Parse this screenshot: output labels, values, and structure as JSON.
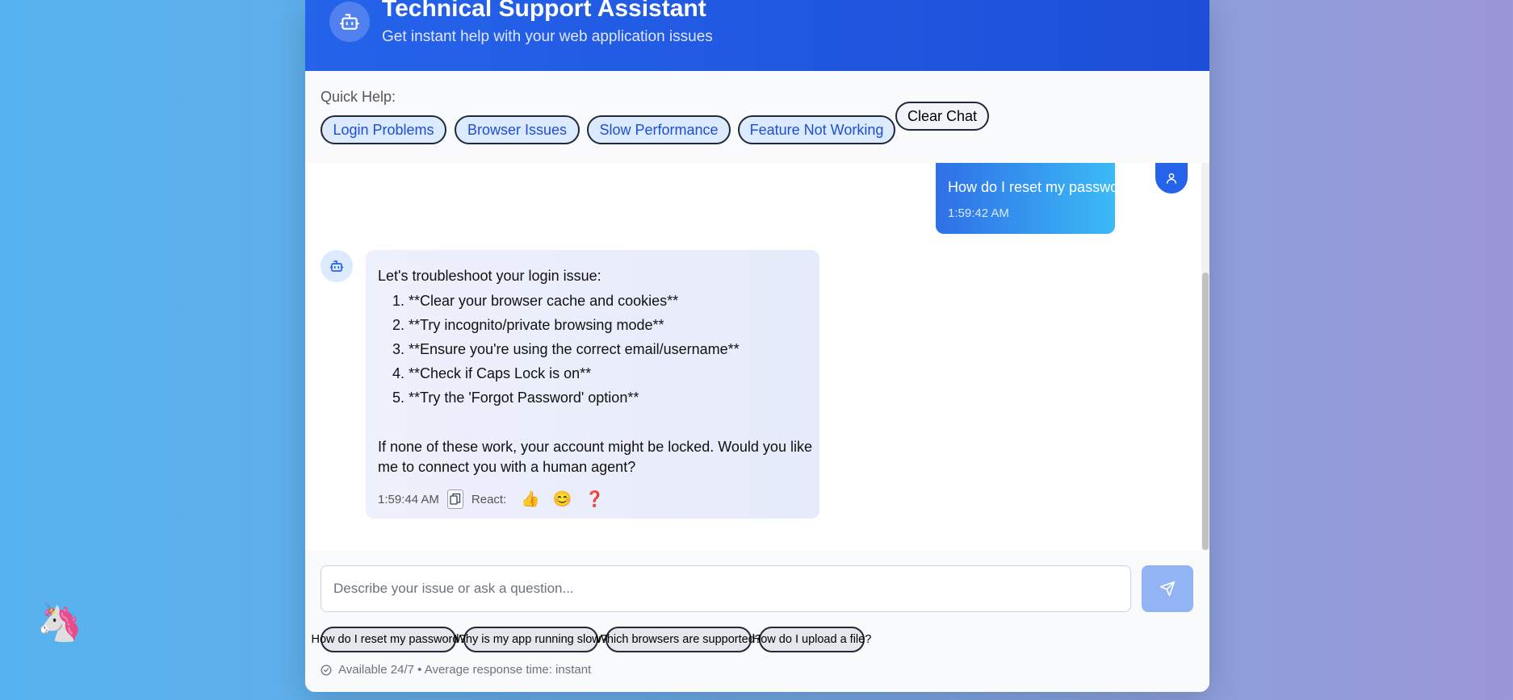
{
  "header": {
    "title": "Technical Support Assistant",
    "subtitle": "Get instant help with your web application issues",
    "icon": "robot-icon"
  },
  "quick_help": {
    "label": "Quick Help:",
    "buttons": [
      "Login Problems",
      "Browser Issues",
      "Slow Performance",
      "Feature Not Working"
    ],
    "clear_label": "Clear Chat"
  },
  "messages": {
    "user": {
      "text": "How do I reset my password?",
      "time": "1:59:42 AM",
      "avatar_icon": "user-icon"
    },
    "bot": {
      "intro": "Let's troubleshoot your login issue:",
      "steps": [
        "**Clear your browser cache and cookies**",
        "**Try incognito/private browsing mode**",
        "**Ensure you're using the correct email/username**",
        "**Check if Caps Lock is on**",
        "**Try the 'Forgot Password' option**"
      ],
      "outro": "If none of these work, your account might be locked. Would you like me to connect you with a human agent?",
      "time": "1:59:44 AM",
      "react_label": "React:",
      "reactions": [
        "👍",
        "😊",
        "❓"
      ],
      "avatar_icon": "robot-icon"
    }
  },
  "input": {
    "placeholder": "Describe your issue or ask a question...",
    "value": "",
    "send_icon": "send-icon"
  },
  "suggestions": [
    "How do I reset my password?",
    "Why is my app running slow?",
    "Which browsers are supported?",
    "How do I upload a file?"
  ],
  "status": {
    "text": "Available 24/7 • Average response time: instant",
    "icon": "check-circle-icon"
  },
  "floating": {
    "emoji": "🦄"
  },
  "colors": {
    "primary": "#2563eb",
    "chip_bg": "#dbeafe",
    "send_disabled": "#93b4f4"
  }
}
